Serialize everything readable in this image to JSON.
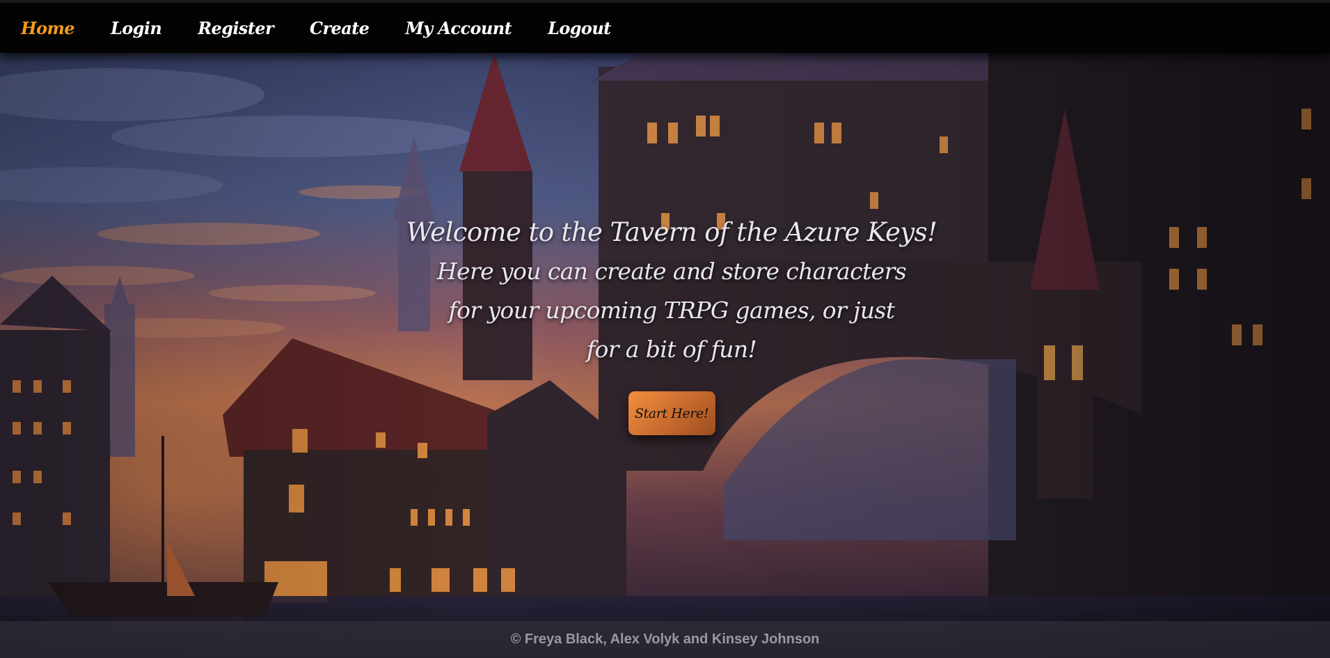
{
  "nav": {
    "items": [
      {
        "label": "Home",
        "active": true
      },
      {
        "label": "Login",
        "active": false
      },
      {
        "label": "Register",
        "active": false
      },
      {
        "label": "Create",
        "active": false
      },
      {
        "label": "My Account",
        "active": false
      },
      {
        "label": "Logout",
        "active": false
      }
    ],
    "active_color": "#f59a1c"
  },
  "hero": {
    "title": "Welcome to the Tavern of the Azure Keys!",
    "lines": [
      "Here you can create and store characters",
      "for your upcoming TRPG games, or just",
      "for a bit of fun!"
    ],
    "button_label": "Start Here!"
  },
  "footer": {
    "text": "© Freya Black, Alex Volyk and Kinsey Johnson"
  },
  "background": {
    "scene": "medieval fantasy harbour town at dusk",
    "sky_colors": [
      "#5f6c9e",
      "#c9705a",
      "#2d2a46"
    ]
  }
}
